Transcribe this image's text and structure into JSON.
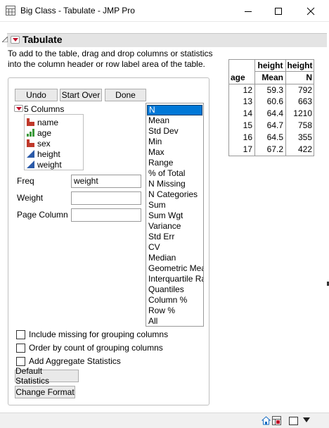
{
  "window": {
    "title": "Big Class - Tabulate - JMP Pro",
    "icon": "window-icon",
    "controls": [
      "minimize-icon",
      "maximize-icon",
      "close-icon"
    ]
  },
  "tabulate": {
    "title": "Tabulate",
    "hint_line1": "To add to the table, drag and drop columns or statistics",
    "hint_line2": "into the column header or row label area of the table."
  },
  "buttons": {
    "undo": "Undo",
    "start_over": "Start Over",
    "done": "Done"
  },
  "columns": {
    "header": "5 Columns",
    "items": [
      {
        "name": "name",
        "type": "nominal",
        "color": "#c0392b"
      },
      {
        "name": "age",
        "type": "ordinal",
        "color": "#3a9a3a"
      },
      {
        "name": "sex",
        "type": "nominal",
        "color": "#c0392b"
      },
      {
        "name": "height",
        "type": "continuous",
        "color": "#2b5aa8"
      },
      {
        "name": "weight",
        "type": "continuous",
        "color": "#2b5aa8"
      }
    ]
  },
  "roles": {
    "freq_label": "Freq",
    "freq_value": "weight",
    "weight_label": "Weight",
    "weight_value": "",
    "page_column_label": "Page Column",
    "page_column_value": ""
  },
  "statistics": {
    "selected": "N",
    "items": [
      "N",
      "Mean",
      "Std Dev",
      "Min",
      "Max",
      "Range",
      "% of Total",
      "N Missing",
      "N Categories",
      "Sum",
      "Sum Wgt",
      "Variance",
      "Std Err",
      "CV",
      "Median",
      "Geometric Mean",
      "Interquartile Range",
      "Quantiles",
      "Column %",
      "Row %",
      "All"
    ]
  },
  "options": {
    "include_missing": "Include missing for grouping columns",
    "order_by_count": "Order by count of grouping columns",
    "add_aggregate": "Add Aggregate Statistics",
    "default_statistics": "Default Statistics",
    "change_format": "Change Format"
  },
  "result_table": {
    "col_headers_top": [
      "height",
      "height"
    ],
    "col_headers_sub": [
      "Mean",
      "N"
    ],
    "row_header": "age",
    "rows": [
      {
        "age": "12",
        "mean": "59.3",
        "n": "792"
      },
      {
        "age": "13",
        "mean": "60.6",
        "n": "663"
      },
      {
        "age": "14",
        "mean": "64.4",
        "n": "1210"
      },
      {
        "age": "15",
        "mean": "64.7",
        "n": "758"
      },
      {
        "age": "16",
        "mean": "64.5",
        "n": "355"
      },
      {
        "age": "17",
        "mean": "67.2",
        "n": "422"
      }
    ]
  },
  "statusbar": {
    "icons": [
      "home-icon",
      "table-icon",
      "window-toggle-icon",
      "dropdown-icon"
    ]
  }
}
